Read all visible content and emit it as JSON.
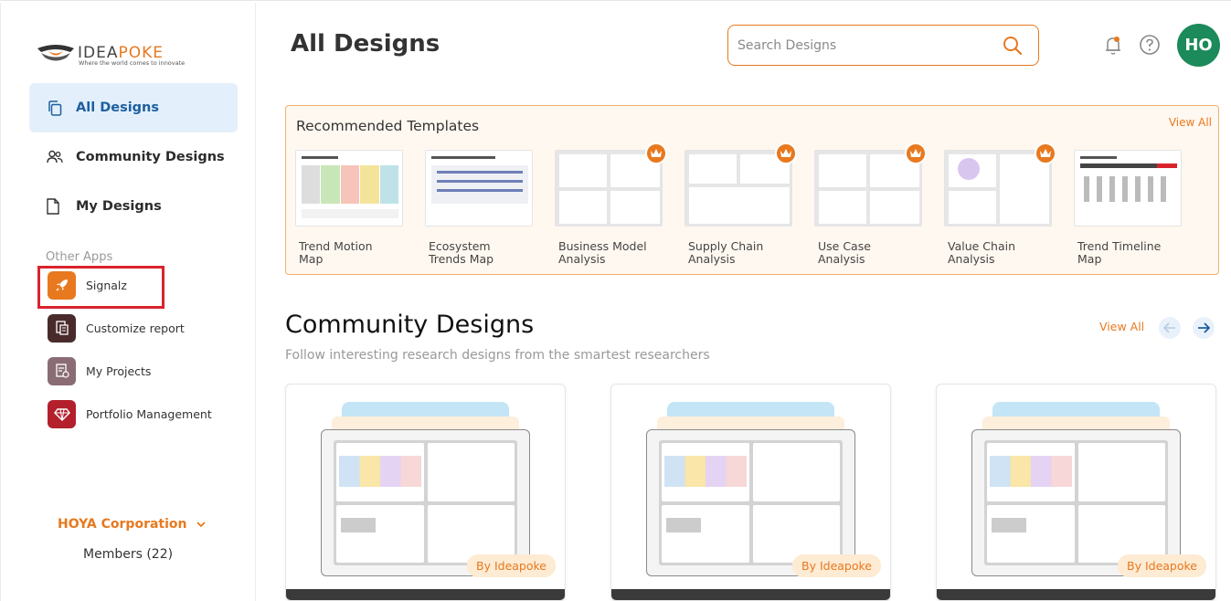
{
  "brand": {
    "logo_prefix": "IDEA",
    "logo_suffix": "POKE",
    "tagline": "Where the world comes to innovate"
  },
  "sidebar": {
    "nav": [
      {
        "label": "All Designs",
        "icon": "copy-icon",
        "active": true
      },
      {
        "label": "Community Designs",
        "icon": "users-icon",
        "active": false
      },
      {
        "label": "My Designs",
        "icon": "file-icon",
        "active": false
      }
    ],
    "other_apps_title": "Other Apps",
    "apps": [
      {
        "label": "Signalz",
        "icon": "rocket-icon",
        "color": "#e8791f"
      },
      {
        "label": "Customize report",
        "icon": "report-icon",
        "color": "#4a2b2b"
      },
      {
        "label": "My Projects",
        "icon": "projects-icon",
        "color": "#8a6d74"
      },
      {
        "label": "Portfolio Management",
        "icon": "diamond-icon",
        "color": "#b3202c"
      }
    ],
    "org_name": "HOYA Corporation",
    "members": "Members (22)"
  },
  "header": {
    "title": "All Designs",
    "search_placeholder": "Search Designs",
    "avatar_initials": "HO"
  },
  "recommended": {
    "title": "Recommended Templates",
    "view_all": "View All",
    "templates": [
      {
        "label": "Trend Motion Map",
        "premium": false
      },
      {
        "label": "Ecosystem Trends Map",
        "premium": false
      },
      {
        "label": "Business Model Analysis",
        "premium": true
      },
      {
        "label": "Supply Chain Analysis",
        "premium": true
      },
      {
        "label": "Use Case Analysis",
        "premium": true
      },
      {
        "label": "Value Chain Analysis",
        "premium": true
      },
      {
        "label": "Trend Timeline Map",
        "premium": false
      }
    ]
  },
  "community": {
    "title": "Community Designs",
    "subtitle": "Follow interesting research designs from the smartest researchers",
    "view_all": "View All",
    "cards": [
      {
        "by": "By Ideapoke"
      },
      {
        "by": "By Ideapoke"
      },
      {
        "by": "By Ideapoke"
      }
    ]
  },
  "colors": {
    "accent": "#e8791f",
    "active_bg": "#e3f0fb",
    "active_text": "#1e5fa0",
    "avatar": "#1c8a5a",
    "highlight_box": "#d9232c"
  }
}
